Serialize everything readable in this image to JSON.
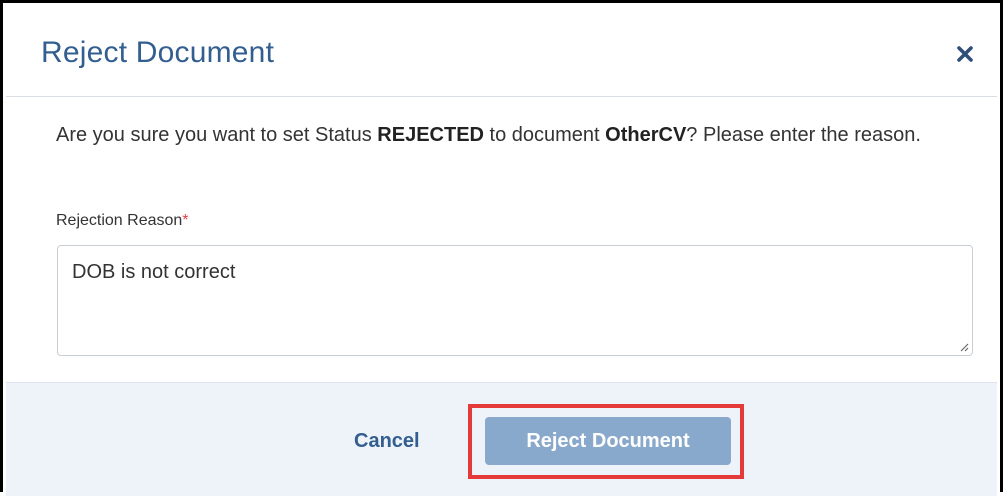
{
  "dialog": {
    "title": "Reject Document",
    "close_icon": "close-icon",
    "message": {
      "part1": "Are you sure you want to set Status ",
      "status": "REJECTED",
      "part2": " to document ",
      "document": "OtherCV",
      "part3": "? Please enter the reason."
    },
    "field": {
      "label": "Rejection Reason",
      "required_marker": "*",
      "value": "DOB is not correct"
    },
    "footer": {
      "cancel_label": "Cancel",
      "reject_label": "Reject Document"
    }
  },
  "colors": {
    "title": "#335e90",
    "primary_button": "#89a9cc",
    "footer_bg": "#eef3f9",
    "highlight": "#e43a3a",
    "required": "#e0424b"
  }
}
